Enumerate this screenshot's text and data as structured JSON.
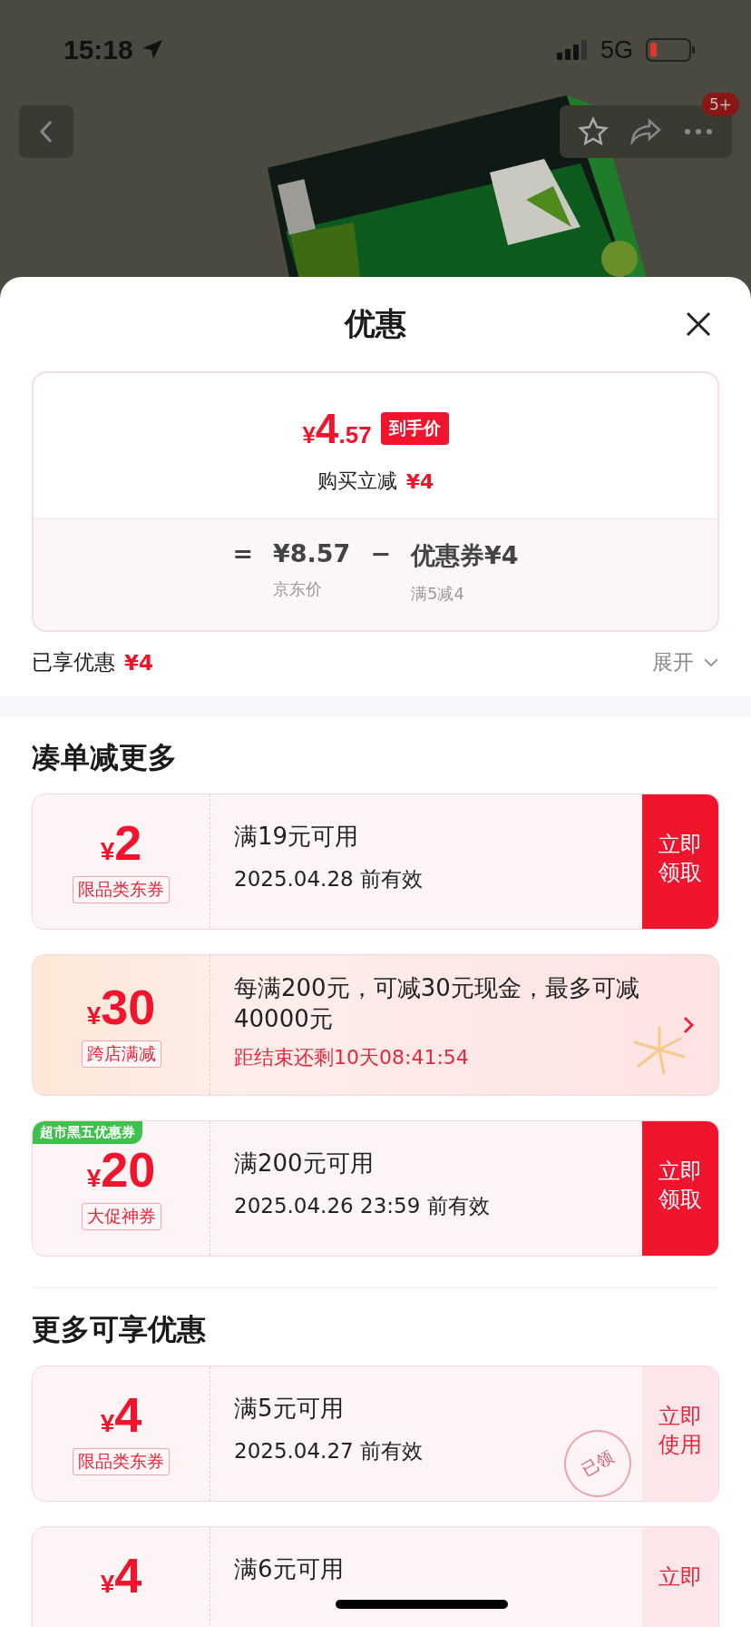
{
  "status_bar": {
    "time": "15:18",
    "network": "5G",
    "battery_low": true
  },
  "nav": {
    "cart_badge": "5+"
  },
  "sheet": {
    "title": "优惠",
    "price_card": {
      "symbol": "¥",
      "integer": "4",
      "decimal": ".57",
      "tag": "到手价",
      "instant_label": "购买立减",
      "instant_value": "¥4",
      "formula": [
        {
          "kind": "op",
          "value": "="
        },
        {
          "kind": "term",
          "value": "¥8.57",
          "label": "京东价"
        },
        {
          "kind": "op",
          "value": "−"
        },
        {
          "kind": "term",
          "value": "优惠券¥4",
          "label": "满5减4"
        }
      ]
    },
    "enjoyed": {
      "label": "已享优惠",
      "value": "¥4",
      "expand": "展开"
    },
    "sections": [
      {
        "title": "凑单减更多",
        "coupons": [
          {
            "kind": "claim",
            "symbol": "¥",
            "amount": "2",
            "tag": "限品类东券",
            "condition": "满19元可用",
            "validity": "2025.04.28 前有效",
            "button": "立即领取"
          },
          {
            "kind": "promo",
            "symbol": "¥",
            "amount": "30",
            "tag": "跨店满减",
            "condition": "每满200元，可减30元现金，最多可减40000元",
            "countdown": "距结束还剩10天08:41:54"
          },
          {
            "kind": "claim",
            "ribbon": "超市黑五优惠券",
            "symbol": "¥",
            "amount": "20",
            "tag": "大促神券",
            "condition": "满200元可用",
            "validity": "2025.04.26 23:59 前有效",
            "button": "立即领取"
          }
        ]
      },
      {
        "title": "更多可享优惠",
        "coupons": [
          {
            "kind": "use",
            "symbol": "¥",
            "amount": "4",
            "tag": "限品类东券",
            "condition": "满5元可用",
            "validity": "2025.04.27 前有效",
            "button": "立即使用",
            "stamp": "已领"
          },
          {
            "kind": "use",
            "symbol": "¥",
            "amount": "4",
            "condition": "满6元可用",
            "button": "立即"
          }
        ]
      }
    ]
  }
}
